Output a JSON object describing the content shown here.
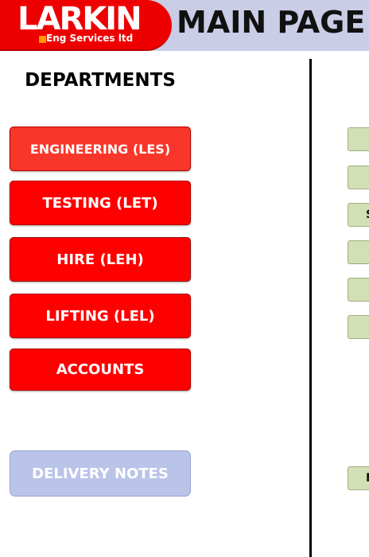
{
  "header": {
    "logo_text": "LARKIN",
    "logo_subtext": "Eng Services ltd",
    "title": "MAIN PAGE"
  },
  "departments": {
    "heading": "DEPARTMENTS",
    "buttons": [
      {
        "label": "ENGINEERING (LES)"
      },
      {
        "label": "TESTING (LET)"
      },
      {
        "label": "HIRE (LEH)"
      },
      {
        "label": "LIFTING (LEL)"
      },
      {
        "label": "ACCOUNTS"
      }
    ],
    "delivery_notes": "DELIVERY NOTES"
  },
  "right_panel": {
    "buttons": [
      {
        "label": ""
      },
      {
        "label": ""
      },
      {
        "label": "S"
      },
      {
        "label": ""
      },
      {
        "label": ""
      },
      {
        "label": ""
      },
      {
        "label": "F"
      }
    ]
  },
  "colors": {
    "header_bg": "#c9cde6",
    "brand_red": "#ee0000",
    "button_red": "#ff0000",
    "delivery_blue": "#bac3e8",
    "mini_green": "#d3dfb4"
  }
}
